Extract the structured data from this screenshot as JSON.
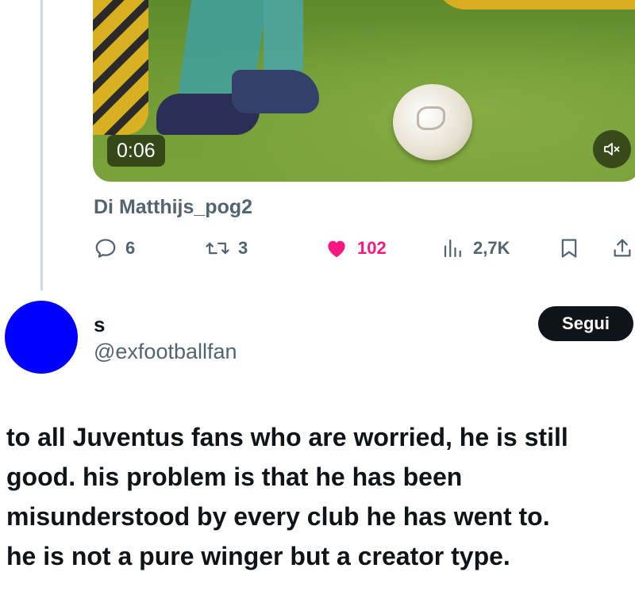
{
  "video": {
    "timestamp": "0:06",
    "mute_icon": "volume-muted-icon"
  },
  "byline": "Di Matthijs_pog2",
  "actions": {
    "replies": "6",
    "reposts": "3",
    "likes": "102",
    "views": "2,7K",
    "like_color": "#f91880",
    "icons": [
      "reply-icon",
      "repost-icon",
      "heart-icon",
      "views-icon",
      "bookmark-icon",
      "share-icon"
    ]
  },
  "author": {
    "name": "s",
    "handle": "@exfootballfan",
    "avatar_color": "#0000ff",
    "follow_label": "Segui"
  },
  "tweet": {
    "lines": [
      "to all Juventus fans who are worried, he is still",
      "good. his problem is that he has been",
      "misunderstood by every club he has went to.",
      "he is not a pure winger but a creator type."
    ]
  }
}
